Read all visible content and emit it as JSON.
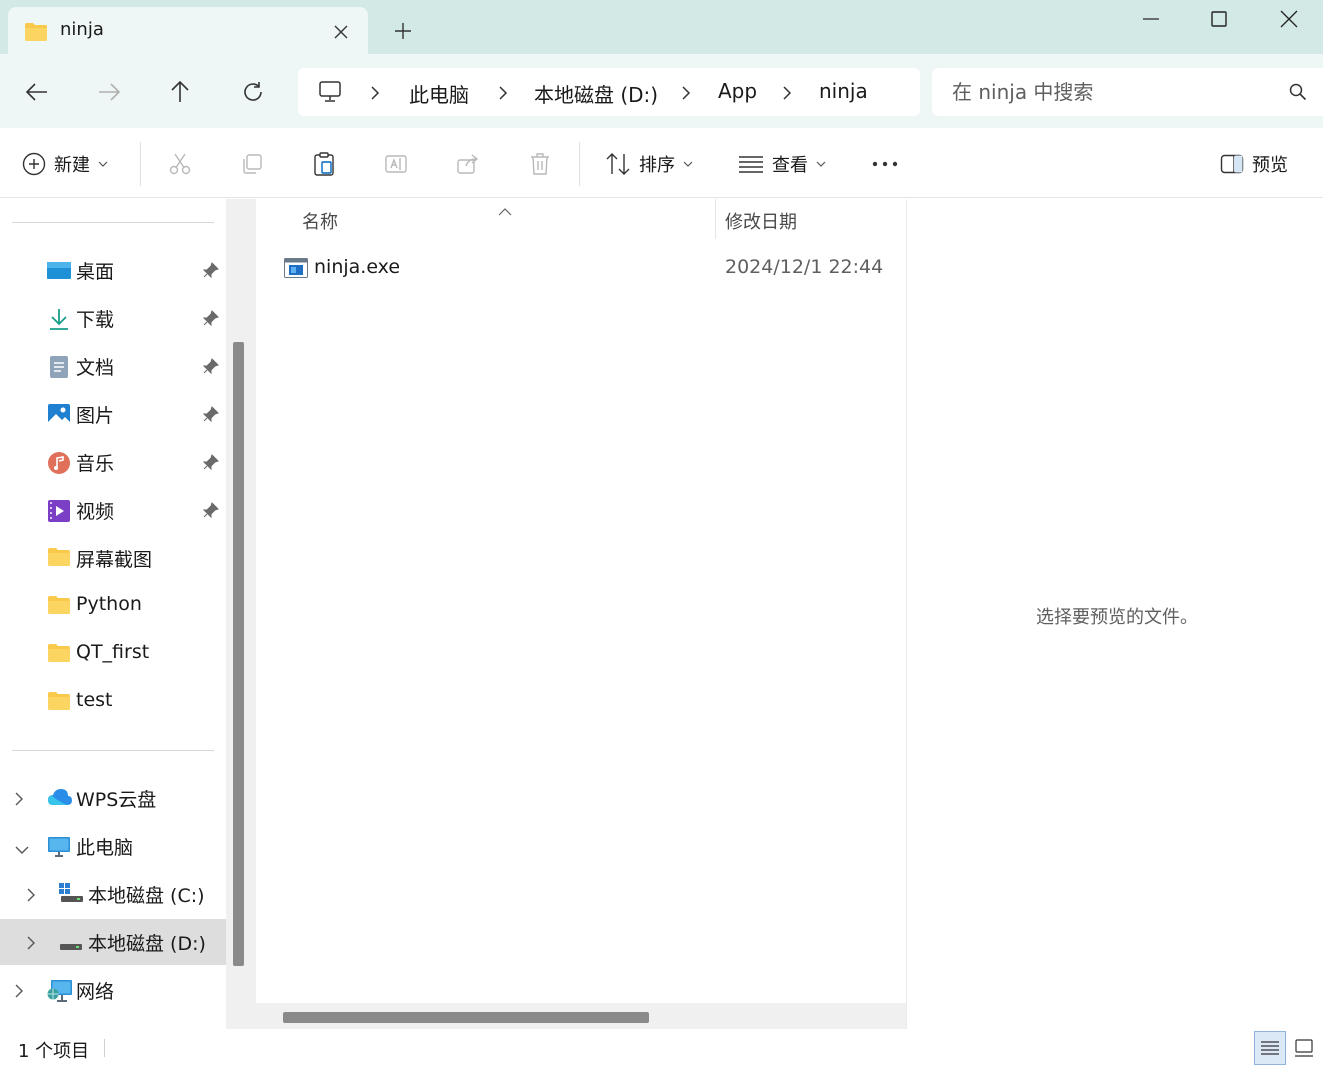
{
  "tab": {
    "title": "ninja",
    "new_tab": "+"
  },
  "breadcrumb": [
    "此电脑",
    "本地磁盘 (D:)",
    "App",
    "ninja"
  ],
  "search": {
    "placeholder": "在 ninja 中搜索"
  },
  "toolbar": {
    "new_label": "新建",
    "sort_label": "排序",
    "view_label": "查看",
    "preview_label": "预览"
  },
  "sidebar": {
    "quick_access": [
      {
        "label": "桌面",
        "icon": "desktop-icon",
        "pinned": true
      },
      {
        "label": "下载",
        "icon": "download-icon",
        "pinned": true
      },
      {
        "label": "文档",
        "icon": "document-icon",
        "pinned": true
      },
      {
        "label": "图片",
        "icon": "pictures-icon",
        "pinned": true
      },
      {
        "label": "音乐",
        "icon": "music-icon",
        "pinned": true
      },
      {
        "label": "视频",
        "icon": "video-icon",
        "pinned": true
      },
      {
        "label": "屏幕截图",
        "icon": "folder-icon",
        "pinned": false
      },
      {
        "label": "Python",
        "icon": "folder-icon",
        "pinned": false
      },
      {
        "label": "QT_first",
        "icon": "folder-icon",
        "pinned": false
      },
      {
        "label": "test",
        "icon": "folder-icon",
        "pinned": false
      }
    ],
    "tree": [
      {
        "label": "WPS云盘",
        "icon": "cloud-icon",
        "expanded": false
      },
      {
        "label": "此电脑",
        "icon": "pc-icon",
        "expanded": true
      },
      {
        "label": "本地磁盘 (C:)",
        "icon": "drive-c-icon",
        "expanded": false
      },
      {
        "label": "本地磁盘 (D:)",
        "icon": "drive-icon",
        "expanded": false,
        "selected": true
      },
      {
        "label": "网络",
        "icon": "network-icon",
        "expanded": false
      }
    ]
  },
  "filelist": {
    "columns": {
      "name": "名称",
      "date": "修改日期"
    },
    "files": [
      {
        "name": "ninja.exe",
        "modified": "2024/12/1 22:44",
        "icon": "exe-icon"
      }
    ]
  },
  "preview": {
    "message": "选择要预览的文件。"
  },
  "status": {
    "item_count": "1 个项目"
  },
  "colors": {
    "titlebar": "#d3e9e6",
    "navbar": "#eef7f5",
    "folder": "#f8c94a",
    "accent": "#0067c0"
  }
}
